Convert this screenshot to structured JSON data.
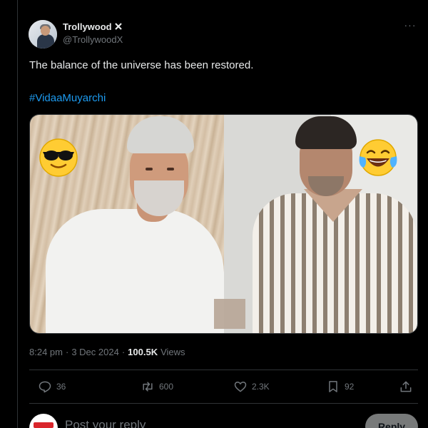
{
  "tweet": {
    "display_name": "Trollywood",
    "handle": "@TrollywoodX",
    "more_label": "···",
    "text": "The balance of the universe has been restored.",
    "hashtag": "#VidaaMuyarchi",
    "media": {
      "left_emoji": "cool-sunglasses-emoji",
      "right_emoji": "tears-of-joy-emoji"
    },
    "time": "8:24 pm",
    "separator": "·",
    "date": "3 Dec 2024",
    "separator2": "·",
    "views_count": "100.5K",
    "views_label": "Views"
  },
  "actions": {
    "replies": "36",
    "reposts": "600",
    "likes": "2.3K",
    "bookmarks": "92"
  },
  "reply": {
    "placeholder": "Post your reply",
    "button_label": "Reply"
  },
  "colors": {
    "background": "#000000",
    "text": "#e7e9ea",
    "muted": "#71767b",
    "link": "#1d9bf0",
    "border": "#2f3336"
  }
}
